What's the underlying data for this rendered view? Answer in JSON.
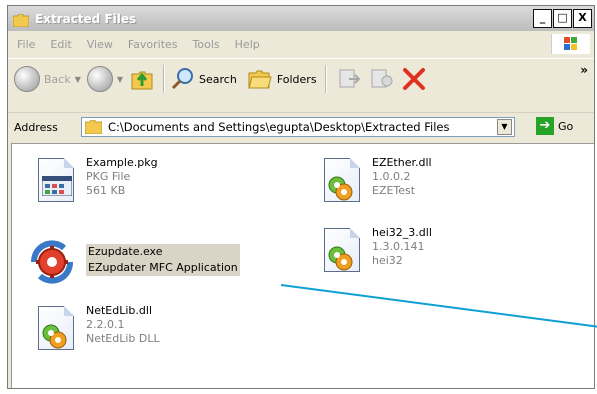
{
  "window": {
    "title": "Extracted Files"
  },
  "title_buttons": {
    "minimize": "_",
    "maximize": "□",
    "close": "X"
  },
  "menu": [
    "File",
    "Edit",
    "View",
    "Favorites",
    "Tools",
    "Help"
  ],
  "toolbar": {
    "back": "Back",
    "search": "Search",
    "folders": "Folders",
    "overflow": "»"
  },
  "address": {
    "label": "Address",
    "path": "C:\\Documents and Settings\\egupta\\Desktop\\Extracted Files",
    "go": "Go"
  },
  "files": [
    {
      "name": "Example.pkg",
      "line2": "PKG File",
      "line3": "561 KB",
      "icon": "pkg-file-icon"
    },
    {
      "name": "EZEther.dll",
      "line2": "1.0.0.2",
      "line3": "EZETest",
      "icon": "dll-file-icon"
    },
    {
      "name": "Ezupdate.exe",
      "line2": "EZupdater MFC Application",
      "icon": "exe-gear-icon"
    },
    {
      "name": "hei32_3.dll",
      "line2": "1.3.0.141",
      "line3": "hei32",
      "icon": "dll-file-icon"
    },
    {
      "name": "NetEdLib.dll",
      "line2": "2.2.0.1",
      "line3": "NetEdLib DLL",
      "icon": "dll-file-icon"
    }
  ],
  "colors": {
    "accent_line": "#0fa0d2",
    "go_green": "#27a327",
    "stop_red": "#e0301e"
  }
}
